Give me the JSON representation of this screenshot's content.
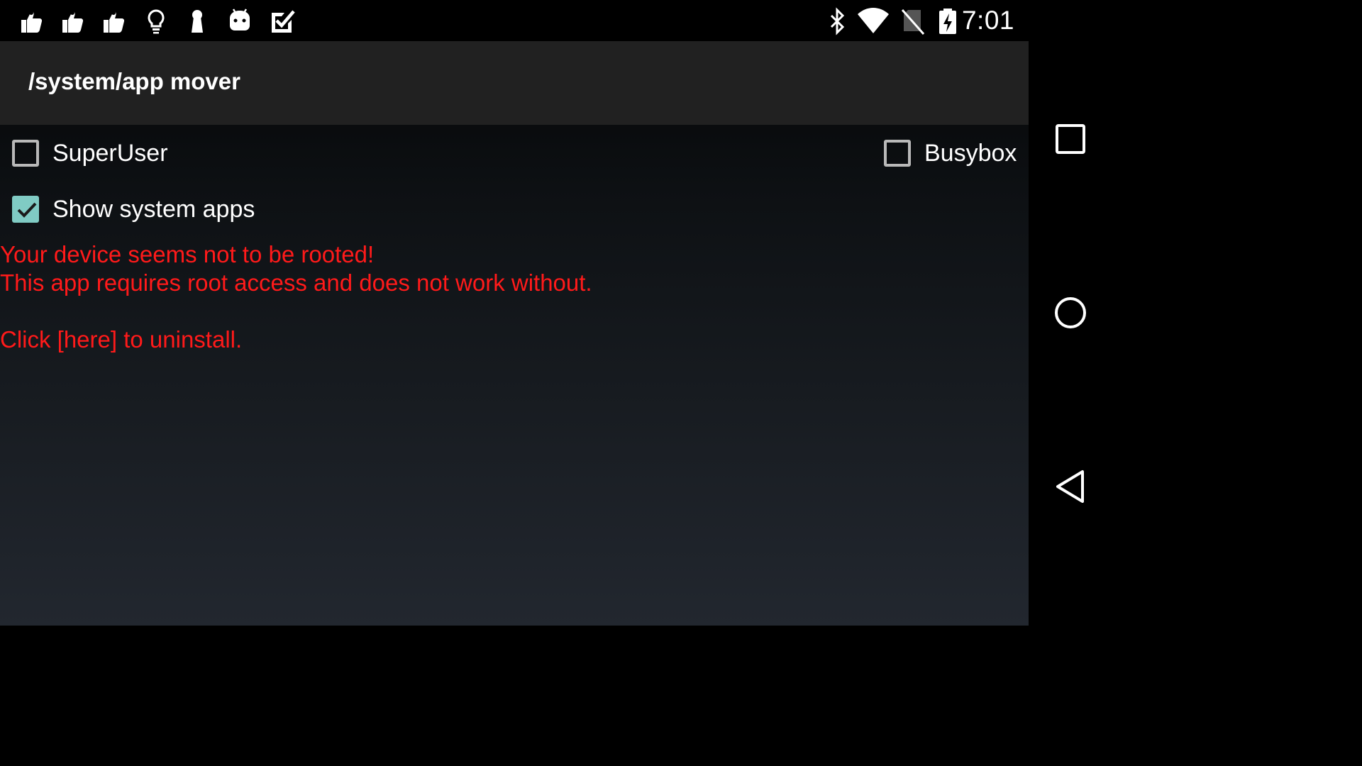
{
  "status_bar": {
    "time": "7:01",
    "left_icons": [
      "thumbs-up-icon",
      "thumbs-up-icon",
      "thumbs-up-icon",
      "lightbulb-icon",
      "keyhole-icon",
      "android-icon",
      "check-tasks-icon"
    ],
    "right_icons": [
      "bluetooth-icon",
      "wifi-icon",
      "no-sim-icon",
      "battery-charging-icon"
    ]
  },
  "action_bar": {
    "title": "/system/app mover"
  },
  "options": {
    "superuser": {
      "label": "SuperUser",
      "checked": false
    },
    "busybox": {
      "label": "Busybox",
      "checked": false
    },
    "show_system_apps": {
      "label": "Show system apps",
      "checked": true
    }
  },
  "error": {
    "line1": "Your device seems not to be rooted!",
    "line2": "This app requires root access and does not work without.",
    "line3": "Click [here] to uninstall."
  },
  "nav_bar": {
    "buttons": [
      "recents-icon",
      "home-icon",
      "back-icon"
    ]
  },
  "colors": {
    "error_text": "#ff1a1a",
    "accent": "#80cbc4",
    "action_bar": "#212121"
  }
}
